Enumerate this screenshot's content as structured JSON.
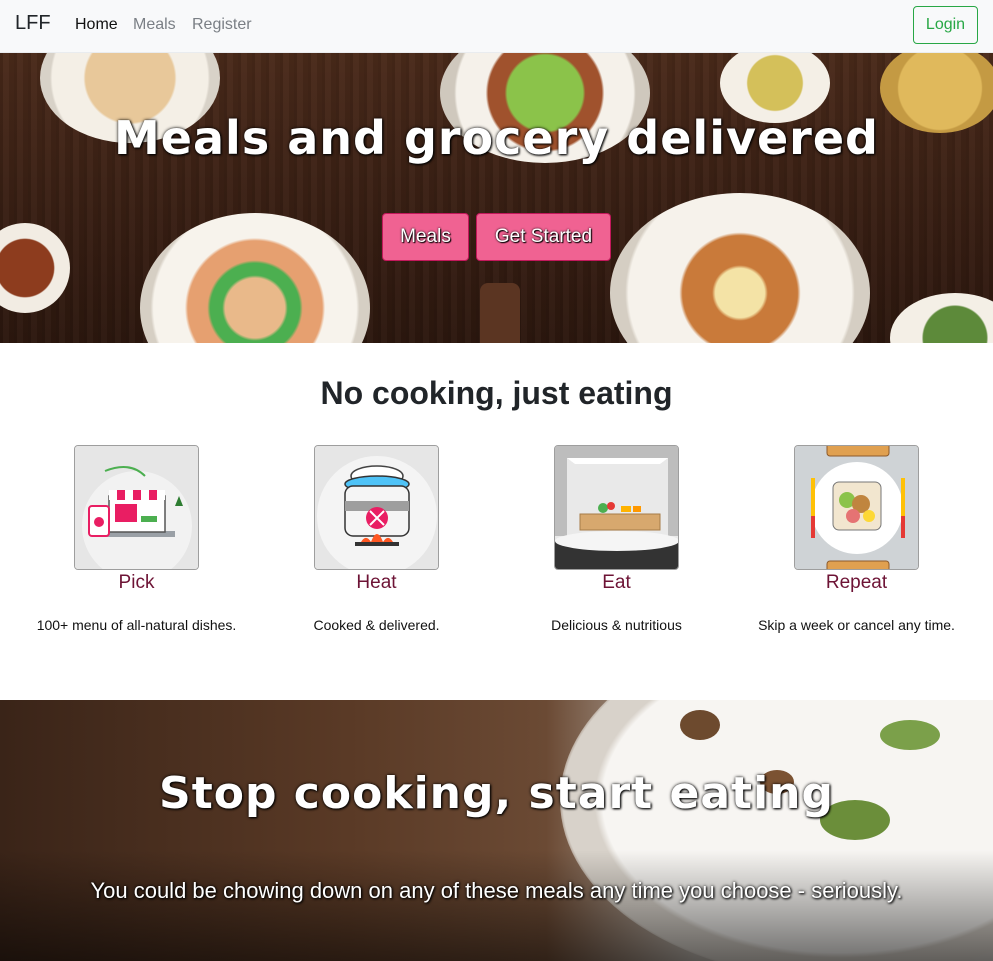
{
  "navbar": {
    "brand": "LFF",
    "links": [
      {
        "label": "Home",
        "active": true
      },
      {
        "label": "Meals",
        "active": false
      },
      {
        "label": "Register",
        "active": false
      }
    ],
    "login_label": "Login",
    "login_color": "#28a745"
  },
  "hero": {
    "title": "Meals and grocery delivered",
    "buttons": [
      {
        "label": "Meals"
      },
      {
        "label": "Get Started"
      }
    ],
    "button_color": "#f06292"
  },
  "how": {
    "title": "No cooking, just eating",
    "steps": [
      {
        "name": "Pick",
        "desc": "100+ menu of all-natural dishes.",
        "icon": "storefront-laptop-icon"
      },
      {
        "name": "Heat",
        "desc": "Cooked & delivered.",
        "icon": "cooking-pot-icon"
      },
      {
        "name": "Eat",
        "desc": "Delicious & nutritious",
        "icon": "food-box-icon"
      },
      {
        "name": "Repeat",
        "desc": "Skip a week or cancel any time.",
        "icon": "meal-plate-icon"
      }
    ],
    "step_name_color": "#6d1335"
  },
  "banner": {
    "title": "Stop cooking, start eating",
    "subtitle": "You could be chowing down on any of these meals any time you choose - seriously."
  }
}
